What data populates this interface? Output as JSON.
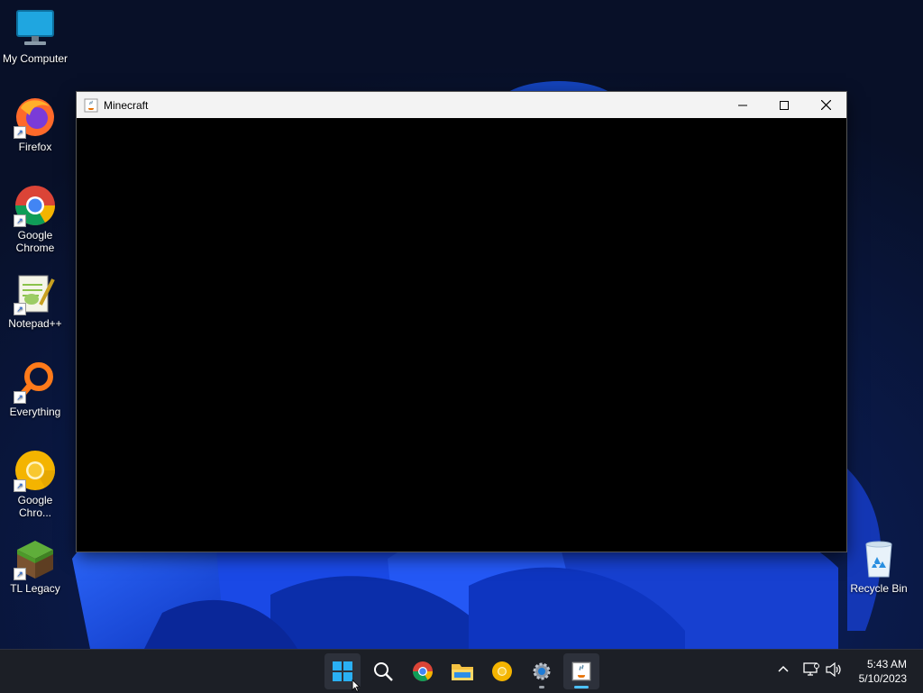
{
  "desktop": {
    "icons": [
      {
        "label": "My Computer",
        "icon": "monitor-icon"
      },
      {
        "label": "Firefox",
        "icon": "firefox-icon"
      },
      {
        "label": "Google\nChrome",
        "icon": "chrome-icon"
      },
      {
        "label": "Notepad++",
        "icon": "notepadpp-icon"
      },
      {
        "label": "Everything",
        "icon": "everything-icon"
      },
      {
        "label": "Google\nChro...",
        "icon": "chrome-canary-icon"
      },
      {
        "label": "TL Legacy",
        "icon": "minecraft-grass-icon"
      },
      {
        "label": "Recycle Bin",
        "icon": "recycle-bin-icon"
      }
    ]
  },
  "window": {
    "title": "Minecraft",
    "app_icon": "java-icon",
    "content_color": "#000000"
  },
  "taskbar": {
    "items": [
      "start-icon",
      "search-icon",
      "chrome-icon",
      "file-explorer-icon",
      "chrome-canary-icon",
      "settings-icon",
      "java-icon"
    ],
    "tray": [
      "chevron-up-icon",
      "network-icon",
      "volume-icon"
    ],
    "time": "5:43 AM",
    "date": "5/10/2023"
  },
  "colors": {
    "accent": "#0078d4",
    "taskbar": "#1c1f26"
  }
}
